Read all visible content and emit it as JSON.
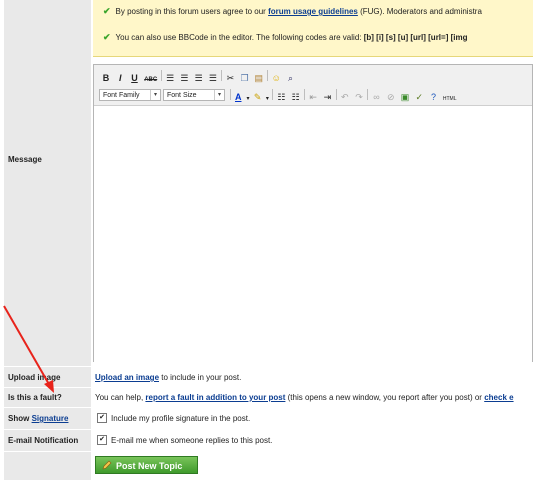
{
  "notice": {
    "line1_prefix": "By posting in this forum users agree to our ",
    "line1_link": "forum usage guidelines",
    "line1_suffix": " (FUG). Moderators and administra",
    "line2_prefix": "You can also use BBCode in the editor. The following codes are valid: ",
    "line2_codes": "[b] [i] [s] [u] [url] [url=] [img"
  },
  "editor": {
    "font_family": "Font Family",
    "font_size": "Font Size",
    "toolbar_row1": [
      "B",
      "I",
      "U",
      "ABC"
    ],
    "html_label": "HTML"
  },
  "labels": {
    "message": "Message",
    "upload_image": "Upload image",
    "is_fault": "Is this a fault?",
    "show_prefix": "Show ",
    "signature": "Signature",
    "email_notification": "E-mail Notification"
  },
  "rows": {
    "upload_link": "Upload an image",
    "upload_suffix": " to include in your post.",
    "fault_prefix": "You can help, ",
    "fault_link": "report a fault in addition to your post",
    "fault_suffix": " (this opens a new window, you report after you post) or ",
    "fault_link2": "check e",
    "signature_text": "Include my profile signature in the post.",
    "email_text": "E-mail me when someone replies to this post."
  },
  "submit_label": "Post New Topic",
  "colors": {
    "accent_green": "#3f9a2c",
    "link": "#0b3d91",
    "notice_bg": "#fff7c9",
    "arrow": "#e8231b"
  }
}
